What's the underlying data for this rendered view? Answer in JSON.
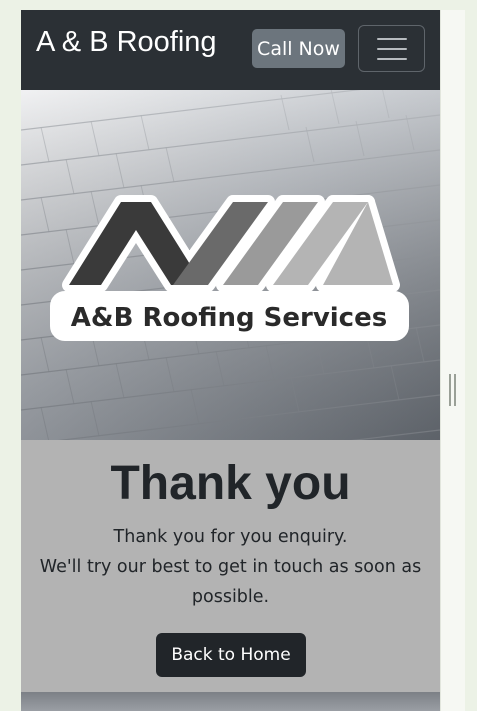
{
  "navbar": {
    "brand": "A & B Roofing",
    "call_label": "Call Now",
    "toggler_icon": "hamburger-icon"
  },
  "hero": {
    "logo_text": "A&B Roofing Services",
    "colors": {
      "dark_bar": "#3a3a3a",
      "mid_bar": "#6a6a6a",
      "light_bar": "#9a9a9a",
      "lighter_bar": "#b4b4b4"
    }
  },
  "thanks": {
    "heading": "Thank you",
    "line1": "Thank you for you enquiry.",
    "line2": "We'll try our best to get in touch as soon as possible.",
    "button_label": "Back to Home"
  },
  "colors": {
    "navbar_bg": "#2b3035",
    "call_button_bg": "#6c757d",
    "section_bg": "#b3b3b3",
    "home_button_bg": "#212529",
    "page_bg": "#ecf2e6"
  }
}
